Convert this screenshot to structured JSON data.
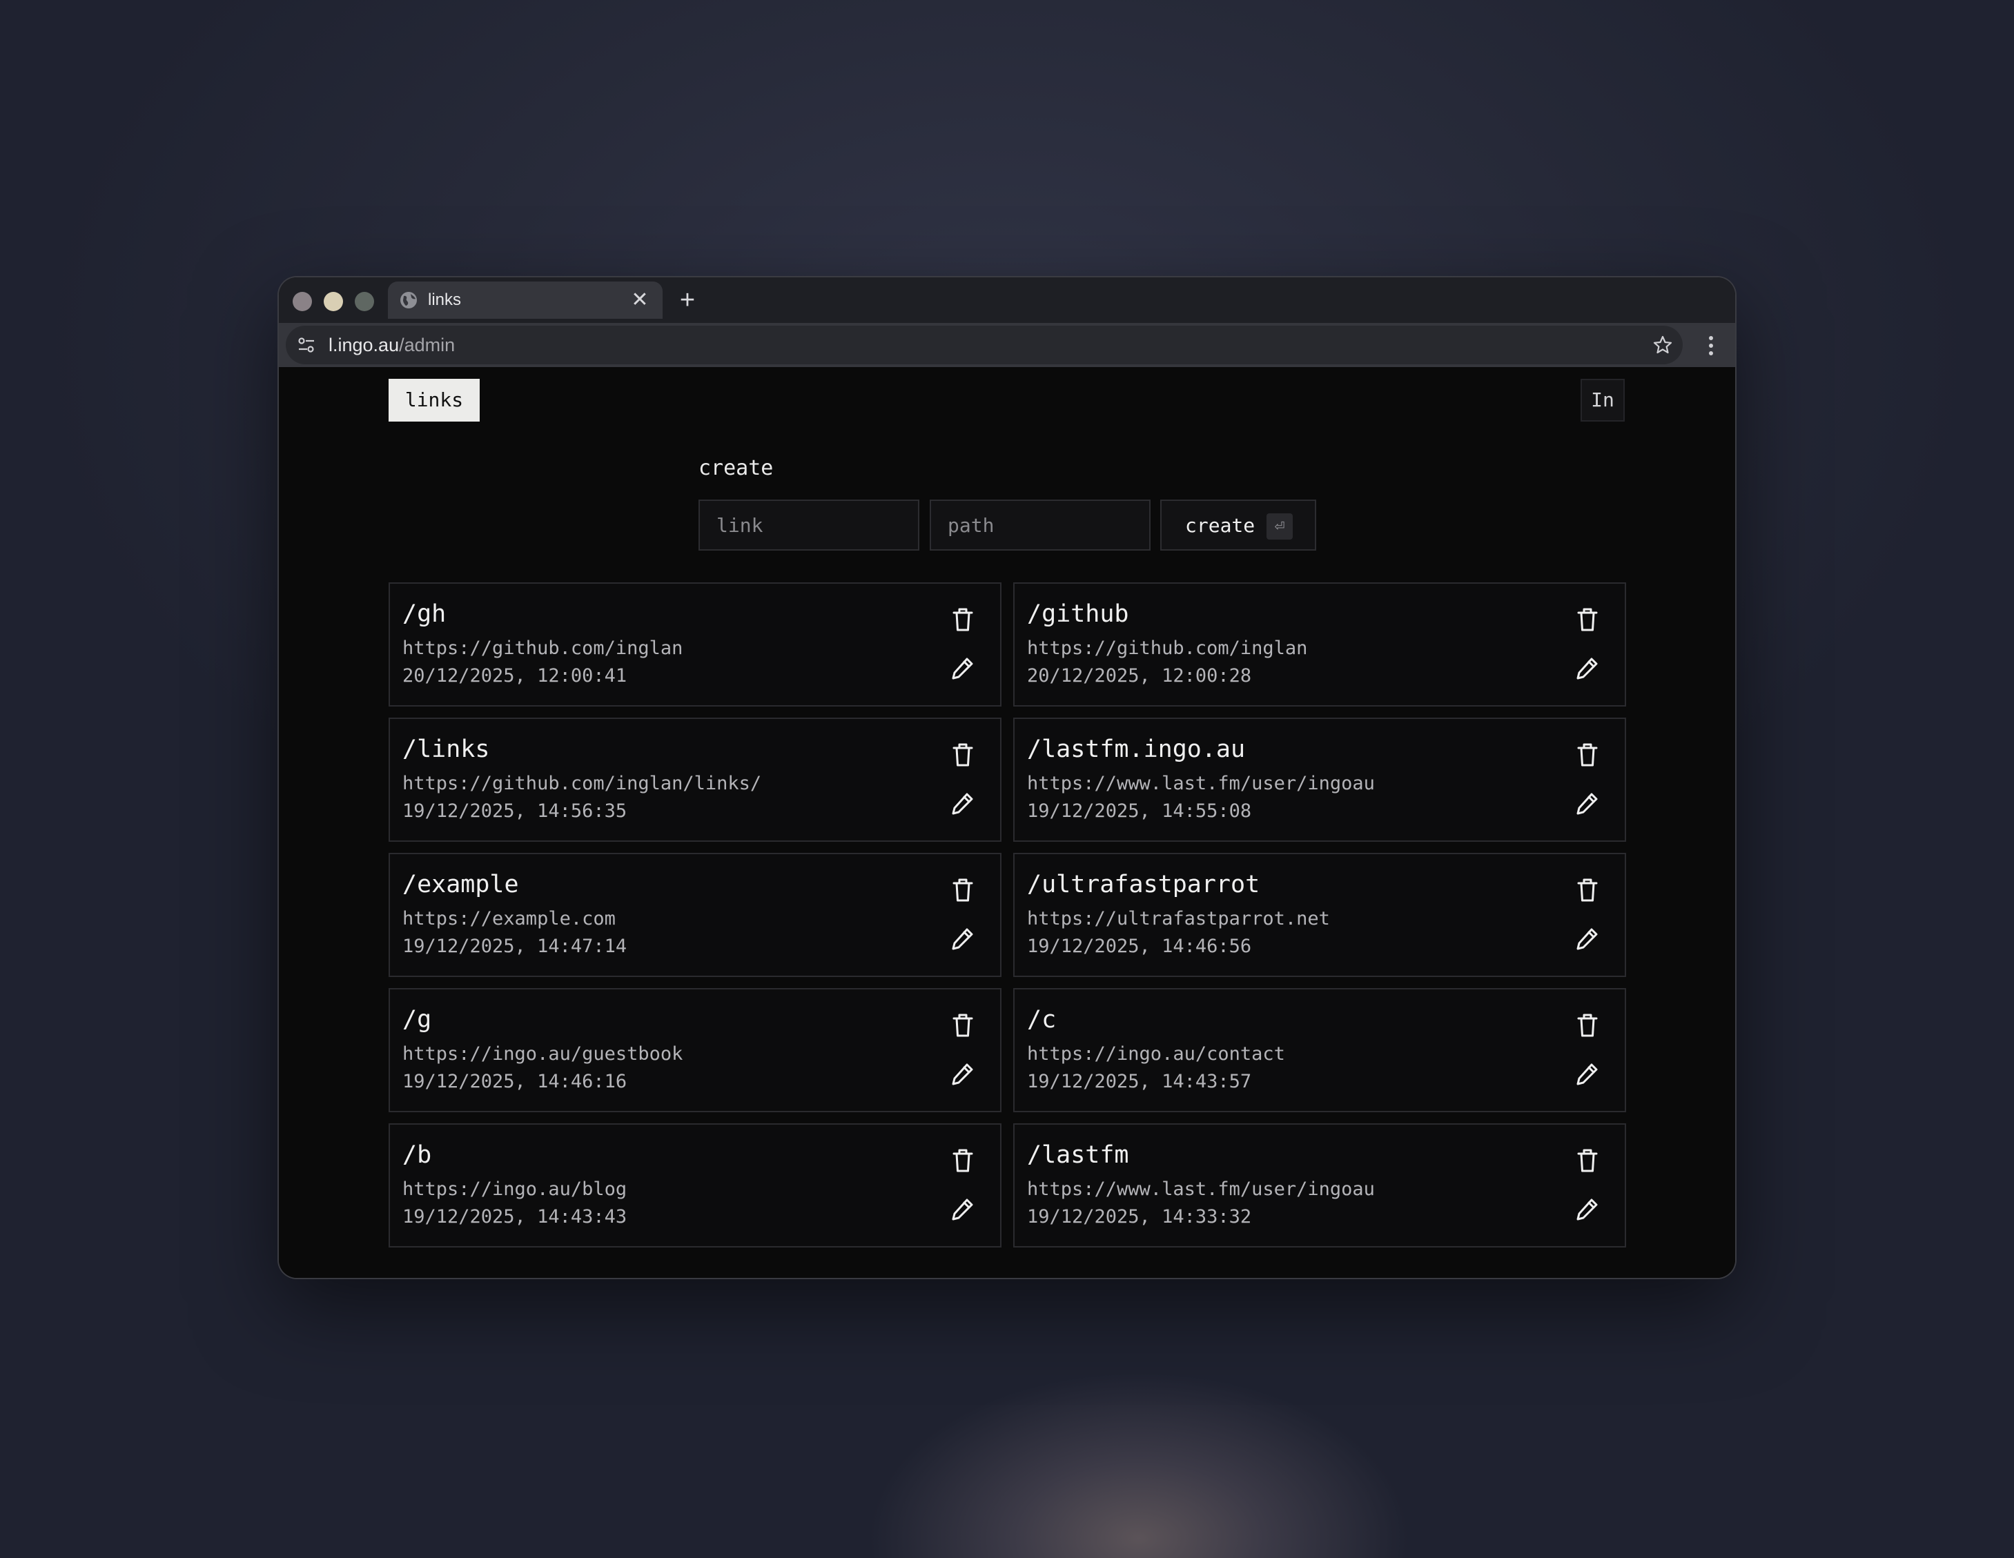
{
  "browser": {
    "tab_title": "links",
    "tab_close_glyph": "✕",
    "new_tab_glyph": "+",
    "url_host": "l.ingo.au",
    "url_path": "/admin",
    "traffic_lights": [
      "#8a8287",
      "#d9cfb4",
      "#5f6762"
    ],
    "icons": [
      "globe-icon",
      "close-icon",
      "plus-icon",
      "tune-icon",
      "star-icon",
      "more-vert-icon"
    ]
  },
  "nav": {
    "brand": "links",
    "lang": "In"
  },
  "create": {
    "heading": "create",
    "link_placeholder": "link",
    "path_placeholder": "path",
    "button_label": "create",
    "enter_glyph": "⏎"
  },
  "links": [
    {
      "path": "/gh",
      "url": "https://github.com/inglan",
      "date": "20/12/2025, 12:00:41"
    },
    {
      "path": "/github",
      "url": "https://github.com/inglan",
      "date": "20/12/2025, 12:00:28"
    },
    {
      "path": "/links",
      "url": "https://github.com/inglan/links/",
      "date": "19/12/2025, 14:56:35"
    },
    {
      "path": "/lastfm.ingo.au",
      "url": "https://www.last.fm/user/ingoau",
      "date": "19/12/2025, 14:55:08"
    },
    {
      "path": "/example",
      "url": "https://example.com",
      "date": "19/12/2025, 14:47:14"
    },
    {
      "path": "/ultrafastparrot",
      "url": "https://ultrafastparrot.net",
      "date": "19/12/2025, 14:46:56"
    },
    {
      "path": "/g",
      "url": "https://ingo.au/guestbook",
      "date": "19/12/2025, 14:46:16"
    },
    {
      "path": "/c",
      "url": "https://ingo.au/contact",
      "date": "19/12/2025, 14:43:57"
    },
    {
      "path": "/b",
      "url": "https://ingo.au/blog",
      "date": "19/12/2025, 14:43:43"
    },
    {
      "path": "/lastfm",
      "url": "https://www.last.fm/user/ingoau",
      "date": "19/12/2025, 14:33:32"
    }
  ],
  "colors": {
    "page_bg": "#0a0a0a",
    "card_border": "#2a2a2e",
    "brand_bg": "#ececea"
  }
}
